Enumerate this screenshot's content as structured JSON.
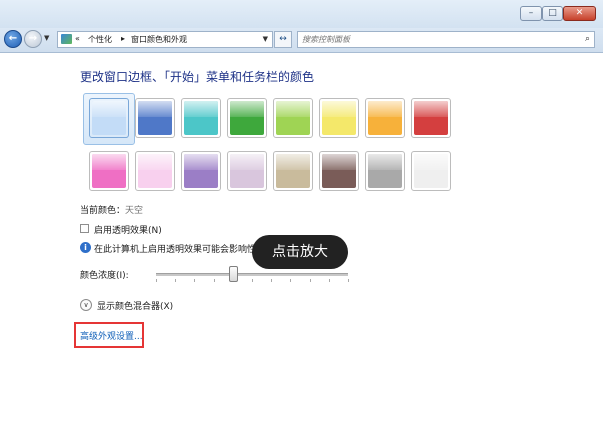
{
  "window": {
    "minimize_glyph": "–",
    "maximize_glyph": "□",
    "close_glyph": "✕"
  },
  "address_bar": {
    "back_glyph": "←",
    "forward_glyph": "→",
    "overflow": "«",
    "separator": "▸",
    "crumbs": [
      "个性化",
      "窗口颜色和外观"
    ],
    "dropdown_glyph": "▼",
    "refresh_glyph": "↔"
  },
  "search": {
    "placeholder": "搜索控制面板",
    "icon_glyph": "⌕"
  },
  "main": {
    "heading": "更改窗口边框、「开始」菜单和任务栏的颜色",
    "current_color_label": "当前颜色：",
    "current_color_value": "天空",
    "transparency_label": "启用透明效果(N)",
    "info_icon_glyph": "i",
    "info_text": "在此计算机上启用透明效果可能会影响性能",
    "intensity_label": "颜色浓度(I):",
    "intensity_value": 0.4,
    "mixer_label": "显示颜色混合器(X)",
    "mixer_glyph": "∨",
    "advanced_link": "高级外观设置..."
  },
  "overlay": {
    "tooltip": "点击放大"
  },
  "swatches": {
    "selected_index": 0,
    "colors": [
      "#c3dcf7",
      "#4f78c8",
      "#4cc6c8",
      "#3ea83c",
      "#9fd454",
      "#f4e86a",
      "#f7b13a",
      "#d43f3f",
      "#ef6fc4",
      "#f8d0ee",
      "#9b7ec6",
      "#d9c6dd",
      "#c9bb9c",
      "#7a5c58",
      "#a9a9a9",
      "#efefef"
    ]
  }
}
